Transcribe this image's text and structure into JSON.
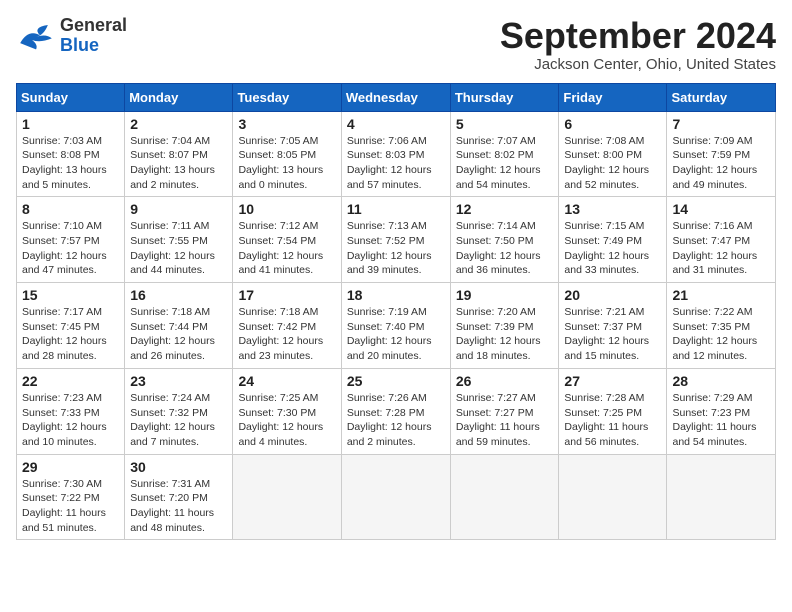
{
  "header": {
    "logo_general": "General",
    "logo_blue": "Blue",
    "month_title": "September 2024",
    "location": "Jackson Center, Ohio, United States"
  },
  "calendar": {
    "days_of_week": [
      "Sunday",
      "Monday",
      "Tuesday",
      "Wednesday",
      "Thursday",
      "Friday",
      "Saturday"
    ],
    "weeks": [
      [
        {
          "day": "1",
          "sunrise": "7:03 AM",
          "sunset": "8:08 PM",
          "daylight": "13 hours and 5 minutes."
        },
        {
          "day": "2",
          "sunrise": "7:04 AM",
          "sunset": "8:07 PM",
          "daylight": "13 hours and 2 minutes."
        },
        {
          "day": "3",
          "sunrise": "7:05 AM",
          "sunset": "8:05 PM",
          "daylight": "13 hours and 0 minutes."
        },
        {
          "day": "4",
          "sunrise": "7:06 AM",
          "sunset": "8:03 PM",
          "daylight": "12 hours and 57 minutes."
        },
        {
          "day": "5",
          "sunrise": "7:07 AM",
          "sunset": "8:02 PM",
          "daylight": "12 hours and 54 minutes."
        },
        {
          "day": "6",
          "sunrise": "7:08 AM",
          "sunset": "8:00 PM",
          "daylight": "12 hours and 52 minutes."
        },
        {
          "day": "7",
          "sunrise": "7:09 AM",
          "sunset": "7:59 PM",
          "daylight": "12 hours and 49 minutes."
        }
      ],
      [
        {
          "day": "8",
          "sunrise": "7:10 AM",
          "sunset": "7:57 PM",
          "daylight": "12 hours and 47 minutes."
        },
        {
          "day": "9",
          "sunrise": "7:11 AM",
          "sunset": "7:55 PM",
          "daylight": "12 hours and 44 minutes."
        },
        {
          "day": "10",
          "sunrise": "7:12 AM",
          "sunset": "7:54 PM",
          "daylight": "12 hours and 41 minutes."
        },
        {
          "day": "11",
          "sunrise": "7:13 AM",
          "sunset": "7:52 PM",
          "daylight": "12 hours and 39 minutes."
        },
        {
          "day": "12",
          "sunrise": "7:14 AM",
          "sunset": "7:50 PM",
          "daylight": "12 hours and 36 minutes."
        },
        {
          "day": "13",
          "sunrise": "7:15 AM",
          "sunset": "7:49 PM",
          "daylight": "12 hours and 33 minutes."
        },
        {
          "day": "14",
          "sunrise": "7:16 AM",
          "sunset": "7:47 PM",
          "daylight": "12 hours and 31 minutes."
        }
      ],
      [
        {
          "day": "15",
          "sunrise": "7:17 AM",
          "sunset": "7:45 PM",
          "daylight": "12 hours and 28 minutes."
        },
        {
          "day": "16",
          "sunrise": "7:18 AM",
          "sunset": "7:44 PM",
          "daylight": "12 hours and 26 minutes."
        },
        {
          "day": "17",
          "sunrise": "7:18 AM",
          "sunset": "7:42 PM",
          "daylight": "12 hours and 23 minutes."
        },
        {
          "day": "18",
          "sunrise": "7:19 AM",
          "sunset": "7:40 PM",
          "daylight": "12 hours and 20 minutes."
        },
        {
          "day": "19",
          "sunrise": "7:20 AM",
          "sunset": "7:39 PM",
          "daylight": "12 hours and 18 minutes."
        },
        {
          "day": "20",
          "sunrise": "7:21 AM",
          "sunset": "7:37 PM",
          "daylight": "12 hours and 15 minutes."
        },
        {
          "day": "21",
          "sunrise": "7:22 AM",
          "sunset": "7:35 PM",
          "daylight": "12 hours and 12 minutes."
        }
      ],
      [
        {
          "day": "22",
          "sunrise": "7:23 AM",
          "sunset": "7:33 PM",
          "daylight": "12 hours and 10 minutes."
        },
        {
          "day": "23",
          "sunrise": "7:24 AM",
          "sunset": "7:32 PM",
          "daylight": "12 hours and 7 minutes."
        },
        {
          "day": "24",
          "sunrise": "7:25 AM",
          "sunset": "7:30 PM",
          "daylight": "12 hours and 4 minutes."
        },
        {
          "day": "25",
          "sunrise": "7:26 AM",
          "sunset": "7:28 PM",
          "daylight": "12 hours and 2 minutes."
        },
        {
          "day": "26",
          "sunrise": "7:27 AM",
          "sunset": "7:27 PM",
          "daylight": "11 hours and 59 minutes."
        },
        {
          "day": "27",
          "sunrise": "7:28 AM",
          "sunset": "7:25 PM",
          "daylight": "11 hours and 56 minutes."
        },
        {
          "day": "28",
          "sunrise": "7:29 AM",
          "sunset": "7:23 PM",
          "daylight": "11 hours and 54 minutes."
        }
      ],
      [
        {
          "day": "29",
          "sunrise": "7:30 AM",
          "sunset": "7:22 PM",
          "daylight": "11 hours and 51 minutes."
        },
        {
          "day": "30",
          "sunrise": "7:31 AM",
          "sunset": "7:20 PM",
          "daylight": "11 hours and 48 minutes."
        },
        null,
        null,
        null,
        null,
        null
      ]
    ]
  }
}
